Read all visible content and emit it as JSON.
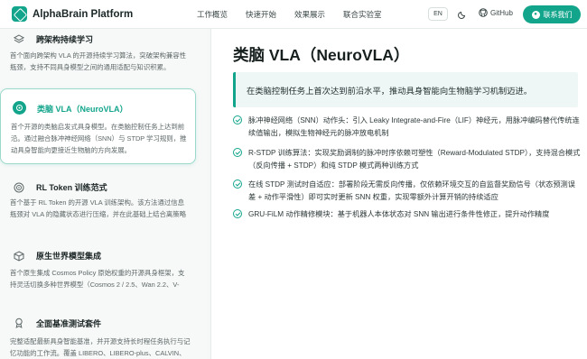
{
  "header": {
    "brand": "AlphaBrain Platform",
    "nav": [
      "工作概览",
      "快速开始",
      "效果展示",
      "联合实验室"
    ],
    "lang": "EN",
    "github": "GitHub",
    "contact": "联系我们"
  },
  "sidebar": {
    "items": [
      {
        "title": "跨架构持续学习",
        "desc": "首个面向跨架构 VLA 的开源持续学习算法，突破架构兼容性瓶颈，支持不同具身模型之间的通用适配与知识积累。",
        "icon": "layers-icon"
      },
      {
        "title": "类脑 VLA（NeuroVLA）",
        "desc": "首个开源的类脑启发式具身模型。在类脑控制任务上达到前沿。通过融合脉冲神经网络（SNN）与 STDP 学习规则，推动具身智能向更接近生物脑的方向发展。",
        "icon": "brain-icon"
      },
      {
        "title": "RL Token 训练范式",
        "desc": "首个基于 RL Token 的开源 VLA 训练架构。该方法通过信息瓶颈对 VLA 的隐藏状态进行压缩，并在此基础上结合离策略",
        "icon": "target-icon"
      },
      {
        "title": "原生世界模型集成",
        "desc": "首个原生集成 Cosmos Policy 原始权重的开源具身框架，支持灵活切换多种世界模型（Cosmos 2 / 2.5、Wan 2.2、V-",
        "icon": "cube-icon"
      },
      {
        "title": "全面基准测试套件",
        "desc": "完整适配最新具身智能基准，并开源支持长时程任务执行与记忆功能的工作流。覆盖 LIBERO、LIBERO-plus、CALVIN、",
        "icon": "medal-icon"
      }
    ]
  },
  "main": {
    "title": "类脑 VLA（NeuroVLA）",
    "quote": "在类脑控制任务上首次达到前沿水平，推动具身智能向生物脑学习机制迈进。",
    "features": [
      "脉冲神经网络（SNN）动作头：引入 Leaky Integrate-and-Fire（LIF）神经元，用脉冲编码替代传统连续值输出，模拟生物神经元的脉冲放电机制",
      "R-STDP 训练算法：实现奖励调制的脉冲时序依赖可塑性（Reward-Modulated STDP），支持混合模式（反向传播 + STDP）和纯 STDP 模式两种训练方式",
      "在线 STDP 测试时自适应：部署阶段无需反向传播，仅依赖环境交互的自监督奖励信号（状态预测误差 + 动作平滑性）即可实时更新 SNN 权重，实现零额外计算开销的持续适应",
      "GRU-FiLM 动作精修模块：基于机器人本体状态对 SNN 输出进行条件性修正，提升动作精度"
    ]
  },
  "colors": {
    "accent": "#12a58c",
    "quote_bg": "#eef7f5"
  }
}
